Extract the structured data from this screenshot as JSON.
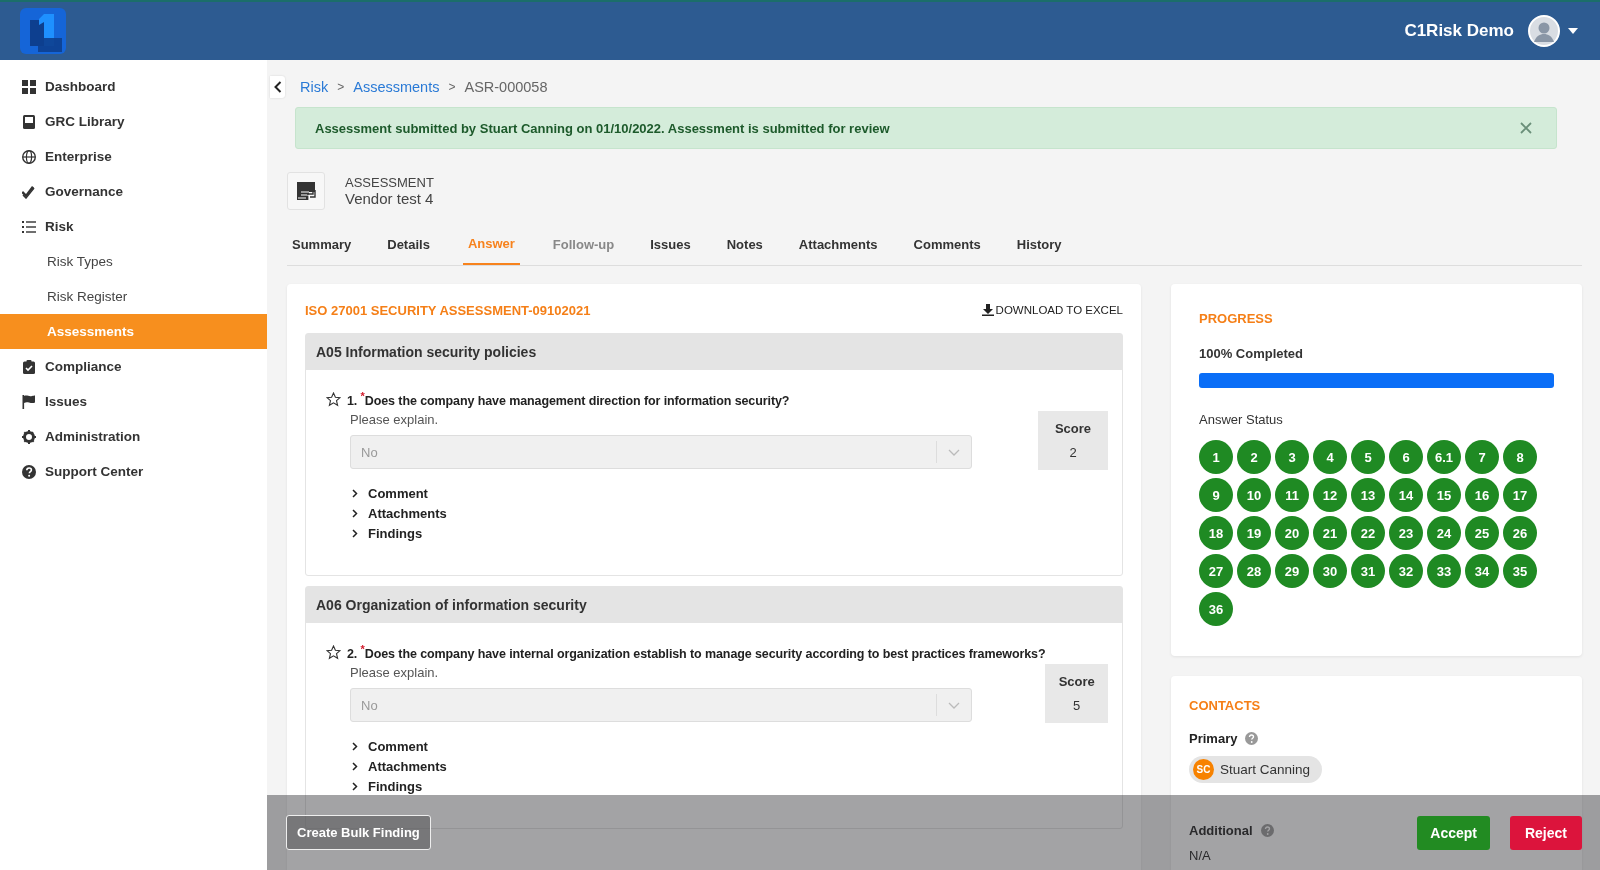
{
  "topbar": {
    "user_name": "C1Risk Demo"
  },
  "sidebar": {
    "items": [
      {
        "label": "Dashboard",
        "selected": false
      },
      {
        "label": "GRC Library",
        "selected": false
      },
      {
        "label": "Enterprise",
        "selected": false
      },
      {
        "label": "Governance",
        "selected": false
      },
      {
        "label": "Risk",
        "selected": false,
        "children": [
          {
            "label": "Risk Types",
            "selected": false
          },
          {
            "label": "Risk Register",
            "selected": false
          },
          {
            "label": "Assessments",
            "selected": true
          }
        ]
      },
      {
        "label": "Compliance",
        "selected": false
      },
      {
        "label": "Issues",
        "selected": false
      },
      {
        "label": "Administration",
        "selected": false
      },
      {
        "label": "Support Center",
        "selected": false
      }
    ]
  },
  "breadcrumb": {
    "separator": ">",
    "items": [
      {
        "label": "Risk",
        "link": true
      },
      {
        "label": "Assessments",
        "link": true
      },
      {
        "label": "ASR-000058",
        "link": false
      }
    ]
  },
  "alert": {
    "message": "Assessment submitted by Stuart Canning on 01/10/2022. Assessment is submitted for review"
  },
  "record": {
    "type_label": "ASSESSMENT",
    "name": "Vendor test 4"
  },
  "tabs": [
    {
      "label": "Summary",
      "selected": false,
      "disabled": false
    },
    {
      "label": "Details",
      "selected": false,
      "disabled": false
    },
    {
      "label": "Answer",
      "selected": true,
      "disabled": false
    },
    {
      "label": "Follow-up",
      "selected": false,
      "disabled": true
    },
    {
      "label": "Issues",
      "selected": false,
      "disabled": false
    },
    {
      "label": "Notes",
      "selected": false,
      "disabled": false
    },
    {
      "label": "Attachments",
      "selected": false,
      "disabled": false
    },
    {
      "label": "Comments",
      "selected": false,
      "disabled": false
    },
    {
      "label": "History",
      "selected": false,
      "disabled": false
    }
  ],
  "questionnaire": {
    "title": "ISO 27001 SECURITY ASSESSMENT-09102021",
    "download_label": "DOWNLOAD TO EXCEL",
    "sections": [
      {
        "title": "A05 Information security policies",
        "questions": [
          {
            "number": "1.",
            "required_mark": "*",
            "text": "Does the company have management direction for information security?",
            "hint": "Please explain.",
            "answer": "No",
            "score_label": "Score",
            "score": "2",
            "expanders": [
              "Comment",
              "Attachments",
              "Findings"
            ]
          }
        ]
      },
      {
        "title": "A06 Organization of information security",
        "questions": [
          {
            "number": "2.",
            "required_mark": "*",
            "text": "Does the company have internal organization establish to manage security according to best practices frameworks?",
            "hint": "Please explain.",
            "answer": "No",
            "score_label": "Score",
            "score": "5",
            "expanders": [
              "Comment",
              "Attachments",
              "Findings"
            ]
          }
        ]
      }
    ]
  },
  "progress": {
    "title": "PROGRESS",
    "label": "100% Completed",
    "level": 1,
    "status_title": "Answer Status",
    "answers": [
      {
        "label": "1",
        "answered": true
      },
      {
        "label": "2",
        "answered": true
      },
      {
        "label": "3",
        "answered": true
      },
      {
        "label": "4",
        "answered": true
      },
      {
        "label": "5",
        "answered": true
      },
      {
        "label": "6",
        "answered": true
      },
      {
        "label": "6.1",
        "answered": true
      },
      {
        "label": "7",
        "answered": true
      },
      {
        "label": "8",
        "answered": true
      },
      {
        "label": "9",
        "answered": true
      },
      {
        "label": "10",
        "answered": true
      },
      {
        "label": "11",
        "answered": true
      },
      {
        "label": "12",
        "answered": true
      },
      {
        "label": "13",
        "answered": true
      },
      {
        "label": "14",
        "answered": true
      },
      {
        "label": "15",
        "answered": true
      },
      {
        "label": "16",
        "answered": true
      },
      {
        "label": "17",
        "answered": true
      },
      {
        "label": "18",
        "answered": true
      },
      {
        "label": "19",
        "answered": true
      },
      {
        "label": "20",
        "answered": true
      },
      {
        "label": "21",
        "answered": true
      },
      {
        "label": "22",
        "answered": true
      },
      {
        "label": "23",
        "answered": true
      },
      {
        "label": "24",
        "answered": true
      },
      {
        "label": "25",
        "answered": true
      },
      {
        "label": "26",
        "answered": true
      },
      {
        "label": "27",
        "answered": true
      },
      {
        "label": "28",
        "answered": true
      },
      {
        "label": "29",
        "answered": true
      },
      {
        "label": "30",
        "answered": true
      },
      {
        "label": "31",
        "answered": true
      },
      {
        "label": "32",
        "answered": true
      },
      {
        "label": "33",
        "answered": true
      },
      {
        "label": "34",
        "answered": true
      },
      {
        "label": "35",
        "answered": true
      },
      {
        "label": "36",
        "answered": true
      }
    ]
  },
  "contacts": {
    "title": "CONTACTS",
    "primary_label": "Primary",
    "primary": [
      {
        "initials": "SC",
        "name": "Stuart Canning"
      }
    ],
    "additional_label": "Additional",
    "additional_value": "N/A"
  },
  "action_bar": {
    "bulk_label": "Create Bulk Finding",
    "accept_label": "Accept",
    "reject_label": "Reject"
  }
}
